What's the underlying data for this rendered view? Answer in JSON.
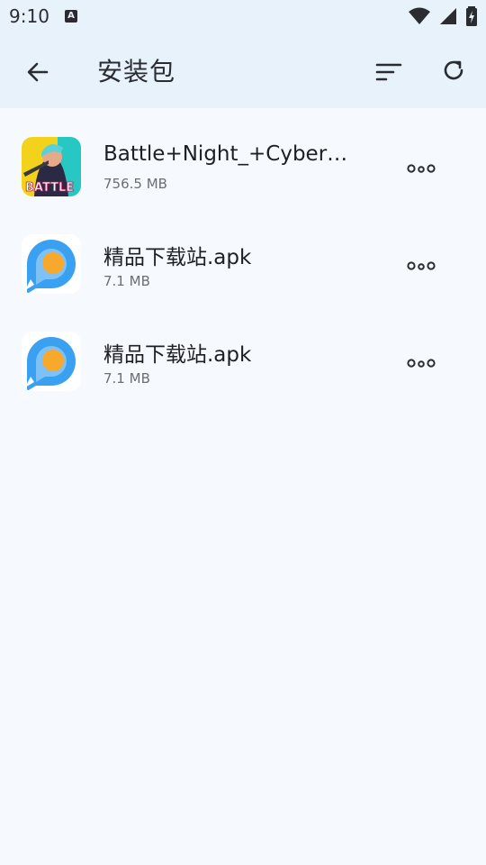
{
  "status_bar": {
    "time": "9:10",
    "notification_letter": "A",
    "icons": [
      "wifi-icon",
      "signal-icon",
      "battery-charging-icon"
    ]
  },
  "app_bar": {
    "title": "安装包",
    "back_icon": "arrow-left-icon",
    "sort_icon": "sort-icon",
    "refresh_icon": "refresh-icon"
  },
  "packages": [
    {
      "name": "Battle+Night_+Cyber…",
      "size": "756.5 MB",
      "icon": "game-icon",
      "more_icon": "more-icon"
    },
    {
      "name": "精品下载站.apk",
      "size": "7.1 MB",
      "icon": "p-logo-icon",
      "more_icon": "more-icon"
    },
    {
      "name": "精品下载站.apk",
      "size": "7.1 MB",
      "icon": "p-logo-icon",
      "more_icon": "more-icon"
    }
  ],
  "colors": {
    "header_bg": "#e8f2fb",
    "page_bg": "#f6f9fd",
    "text_primary": "#1e1f23",
    "text_secondary": "#6b6e75",
    "logo_blue": "#3aa0f2",
    "logo_orange": "#f8a92b"
  }
}
